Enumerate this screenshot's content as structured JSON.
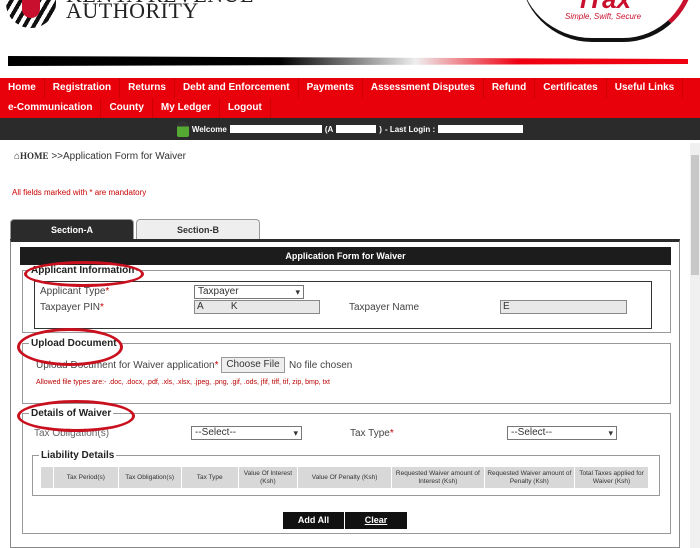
{
  "header": {
    "logo_top": "KENYA REVENUE",
    "logo_text": "AUTHORITY",
    "itax_brand": "iTax",
    "itax_tagline": "Simple, Swift, Secure"
  },
  "nav": {
    "row1": [
      "Home",
      "Registration",
      "Returns",
      "Debt and Enforcement",
      "Payments",
      "Assessment Disputes",
      "Refund",
      "Certificates",
      "Useful Links"
    ],
    "row2": [
      "e-Communication",
      "County",
      "My Ledger",
      "Logout"
    ]
  },
  "welcome": {
    "prefix": "Welcome",
    "paren": "(A",
    "paren_close": ")",
    "last_login": "- Last Login :"
  },
  "breadcrumb": {
    "home": "HOME",
    "current": ">>Application Form for Waiver"
  },
  "mandatory_note": "All fields marked with * are mandatory",
  "tabs": [
    "Section-A",
    "Section-B"
  ],
  "form": {
    "title": "Application Form for Waiver",
    "applicant": {
      "legend": "Applicant Information",
      "type_label": "Applicant Type",
      "type_value": "Taxpayer",
      "pin_label": "Taxpayer PIN",
      "pin_value": "A          K",
      "name_label": "Taxpayer Name",
      "name_value": "E"
    },
    "upload": {
      "legend": "Upload Document",
      "label": "Upload Document for Waiver application",
      "choose": "Choose File",
      "no_file": "No file chosen",
      "allowed": "Allowed file types are:- .doc, .docx, .pdf, .xls, .xlsx, .jpeg, .png, .gif, .ods, jfif, tiff, tif, zip, bmp, txt"
    },
    "waiver": {
      "legend": "Details of Waiver",
      "obligation_label": "Tax Obligation(s)",
      "obligation_value": "--Select--",
      "taxtype_label": "Tax Type",
      "taxtype_value": "--Select--",
      "liability_legend": "Liability Details",
      "columns": [
        "",
        "Tax Period(s)",
        "Tax Obligation(s)",
        "Tax Type",
        "Value Of Interest (Ksh)",
        "Value Of Penalty (Ksh)",
        "Requested Waiver amount of Interest (Ksh)",
        "Requested Waiver amount of Penalty (Ksh)",
        "Total Taxes applied for Waiver (Ksh)"
      ]
    },
    "add_all": "Add All",
    "clear": "Clear"
  },
  "colors": {
    "nav_red": "#e8000b",
    "dark": "#2b2b2b",
    "annotation_red": "#c8101e"
  }
}
